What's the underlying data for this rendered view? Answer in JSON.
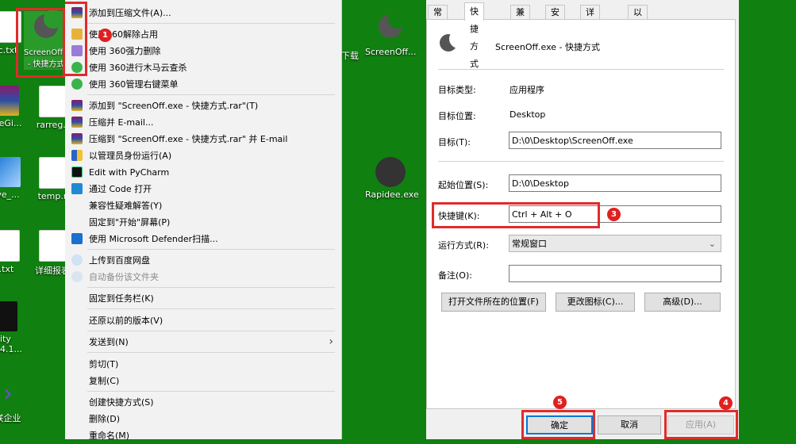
{
  "desktop": {
    "icons": [
      {
        "label": "c.txt"
      },
      {
        "label": "ScreenOff.exe - 快捷方式"
      },
      {
        "label": "pleGi..."
      },
      {
        "label": "rarreg.."
      },
      {
        "label": "ve_..."
      },
      {
        "label": "temp.r"
      },
      {
        "label": ".txt"
      },
      {
        "label": "详细报表"
      },
      {
        "label": "ity"
      },
      {
        "label": "4.1..."
      },
      {
        "label": "联企业"
      },
      {
        "label": "下载"
      },
      {
        "label": "ScreenOff..."
      },
      {
        "label": "Rapidee.exe"
      }
    ]
  },
  "context_menu": {
    "items": [
      {
        "label": "添加到压缩文件(A)...",
        "icon": "winrar-icon"
      },
      {
        "label": "使用360解除占用",
        "icon": "360-unlock-icon"
      },
      {
        "label": "使用 360强力删除",
        "icon": "360-delete-icon"
      },
      {
        "label": "使用 360进行木马云查杀",
        "icon": "360-scan-icon"
      },
      {
        "label": "使用 360管理右键菜单",
        "icon": "360-menu-icon"
      },
      {
        "label": "添加到 \"ScreenOff.exe - 快捷方式.rar\"(T)",
        "icon": "winrar-icon"
      },
      {
        "label": "压缩并 E-mail...",
        "icon": "winrar-icon"
      },
      {
        "label": "压缩到 \"ScreenOff.exe - 快捷方式.rar\" 并 E-mail",
        "icon": "winrar-icon"
      },
      {
        "label": "以管理员身份运行(A)",
        "icon": "shield-icon"
      },
      {
        "label": "Edit with PyCharm",
        "icon": "pycharm-icon"
      },
      {
        "label": "通过 Code 打开",
        "icon": "vscode-icon"
      },
      {
        "label": "兼容性疑难解答(Y)",
        "icon": ""
      },
      {
        "label": "固定到\"开始\"屏幕(P)",
        "icon": ""
      },
      {
        "label": "使用 Microsoft Defender扫描...",
        "icon": "defender-icon"
      },
      {
        "label": "上传到百度网盘",
        "icon": "baidu-cloud-icon"
      },
      {
        "label": "自动备份该文件夹",
        "icon": "baidu-cloud-icon"
      },
      {
        "label": "固定到任务栏(K)",
        "icon": ""
      },
      {
        "label": "还原以前的版本(V)",
        "icon": ""
      },
      {
        "label": "发送到(N)",
        "icon": ""
      },
      {
        "label": "剪切(T)",
        "icon": ""
      },
      {
        "label": "复制(C)",
        "icon": ""
      },
      {
        "label": "创建快捷方式(S)",
        "icon": ""
      },
      {
        "label": "删除(D)",
        "icon": ""
      },
      {
        "label": "重命名(M)",
        "icon": ""
      }
    ],
    "submenu_arrow": "›"
  },
  "dialog": {
    "tabs": [
      "常规",
      "快捷方式",
      "兼容性",
      "安全",
      "详细信息",
      "以前的版本"
    ],
    "active_tab": "快捷方式",
    "title": "ScreenOff.exe - 快捷方式",
    "target_type_label": "目标类型:",
    "target_type_value": "应用程序",
    "target_location_label": "目标位置:",
    "target_location_value": "Desktop",
    "target_label": "目标(T):",
    "target_value": "D:\\0\\Desktop\\ScreenOff.exe",
    "start_in_label": "起始位置(S):",
    "start_in_value": "D:\\0\\Desktop",
    "shortcut_key_label": "快捷键(K):",
    "shortcut_key_value": "Ctrl + Alt + O",
    "run_label": "运行方式(R):",
    "run_value": "常规窗口",
    "comment_label": "备注(O):",
    "comment_value": "",
    "open_location_button": "打开文件所在的位置(F)",
    "change_icon_button": "更改图标(C)...",
    "advanced_button": "高级(D)...",
    "ok_button": "确定",
    "cancel_button": "取消",
    "apply_button": "应用(A)"
  },
  "annotations": [
    "1",
    "2",
    "3",
    "4",
    "5"
  ],
  "colors": {
    "desktop_bg": "#108010",
    "annotation_red": "#e02b2b"
  }
}
